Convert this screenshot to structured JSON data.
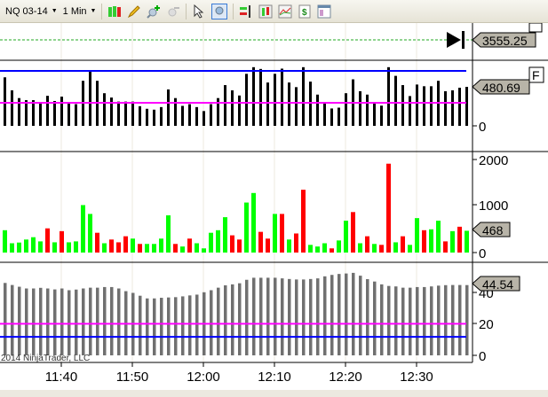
{
  "toolbar": {
    "instrument": "NQ 03-14",
    "interval": "1 Min",
    "icons": [
      "candlestick-style-icon",
      "pencil-draw-icon",
      "zoom-in-icon",
      "zoom-out-icon",
      "cursor-pointer-icon",
      "zoom-box-icon",
      "data-box-icon",
      "chart-style-icon",
      "indicators-icon",
      "strategies-icon",
      "properties-icon"
    ]
  },
  "colors": {
    "up": "#00ff00",
    "down": "#ff0000",
    "blue_line": "#0000ff",
    "magenta_line": "#ff00ff",
    "gray_bar": "#707070",
    "label_bg": "#b8b4a8"
  },
  "panels": {
    "price": {
      "label": "3555.25",
      "flag": "F"
    },
    "indicator": {
      "label": "480.69",
      "flag": "F",
      "axis": [
        "0"
      ],
      "upper_level": 677,
      "lower_level": 284,
      "values": [
        598,
        438,
        342,
        317,
        317,
        278,
        370,
        306,
        360,
        295,
        267,
        555,
        669,
        555,
        402,
        349,
        299,
        299,
        299,
        242,
        210,
        199,
        231,
        449,
        342,
        246,
        267,
        231,
        182,
        267,
        342,
        502,
        438,
        374,
        641,
        723,
        701,
        534,
        641,
        705,
        534,
        477,
        723,
        545,
        385,
        295,
        214,
        224,
        402,
        573,
        427,
        385,
        295,
        249,
        723,
        616,
        502,
        367,
        509,
        488,
        488,
        555,
        427,
        438,
        470,
        480.69
      ]
    },
    "volume": {
      "label": "468",
      "axis": [
        "2000",
        "1000",
        "0"
      ],
      "values": [
        480,
        200,
        215,
        280,
        330,
        240,
        520,
        220,
        460,
        220,
        240,
        1020,
        830,
        425,
        200,
        280,
        220,
        350,
        300,
        185,
        185,
        185,
        300,
        800,
        185,
        130,
        300,
        200,
        90,
        425,
        480,
        760,
        370,
        280,
        1075,
        1280,
        445,
        300,
        830,
        830,
        280,
        410,
        1350,
        165,
        130,
        200,
        90,
        260,
        685,
        870,
        200,
        350,
        185,
        165,
        1910,
        220,
        350,
        165,
        740,
        480,
        500,
        685,
        240,
        460,
        555,
        468
      ],
      "up": [
        1,
        1,
        1,
        1,
        1,
        1,
        0,
        1,
        0,
        1,
        1,
        1,
        1,
        0,
        1,
        0,
        0,
        0,
        1,
        0,
        1,
        1,
        1,
        1,
        0,
        1,
        0,
        1,
        1,
        1,
        1,
        1,
        0,
        0,
        1,
        1,
        0,
        0,
        1,
        0,
        1,
        0,
        0,
        1,
        1,
        1,
        0,
        1,
        1,
        0,
        1,
        0,
        1,
        0,
        0,
        1,
        0,
        1,
        1,
        0,
        1,
        1,
        0,
        1,
        0,
        1
      ]
    },
    "oscillator": {
      "label": "44.54",
      "axis": [
        "40",
        "20",
        "0"
      ],
      "upper_level": 20,
      "lower_level": 11.7,
      "values": [
        45.9,
        44.6,
        43.5,
        42.4,
        42.4,
        42.8,
        42.4,
        41.8,
        42.4,
        41.3,
        41.7,
        42.4,
        42.9,
        42.9,
        43.3,
        43.3,
        42.4,
        40.7,
        39.6,
        37.8,
        36.1,
        36.1,
        36.5,
        36.7,
        36.9,
        37.4,
        38,
        38.5,
        40,
        41.3,
        42.9,
        44.4,
        45,
        45.7,
        47.9,
        49.2,
        49.2,
        49.2,
        49.2,
        48.8,
        48.4,
        48.1,
        48.1,
        48.4,
        48.8,
        50.1,
        51,
        51.6,
        51.9,
        52.3,
        50.5,
        48.3,
        46.8,
        45,
        44,
        43.7,
        42.9,
        42.9,
        43.3,
        43.3,
        43.7,
        44.2,
        44.5,
        44.6,
        44.6,
        44.54
      ]
    },
    "copyright": "2014 NinjaTrader, LLC"
  },
  "xaxis": {
    "ticks": [
      "11:40",
      "11:50",
      "12:00",
      "12:10",
      "12:20",
      "12:30"
    ]
  }
}
